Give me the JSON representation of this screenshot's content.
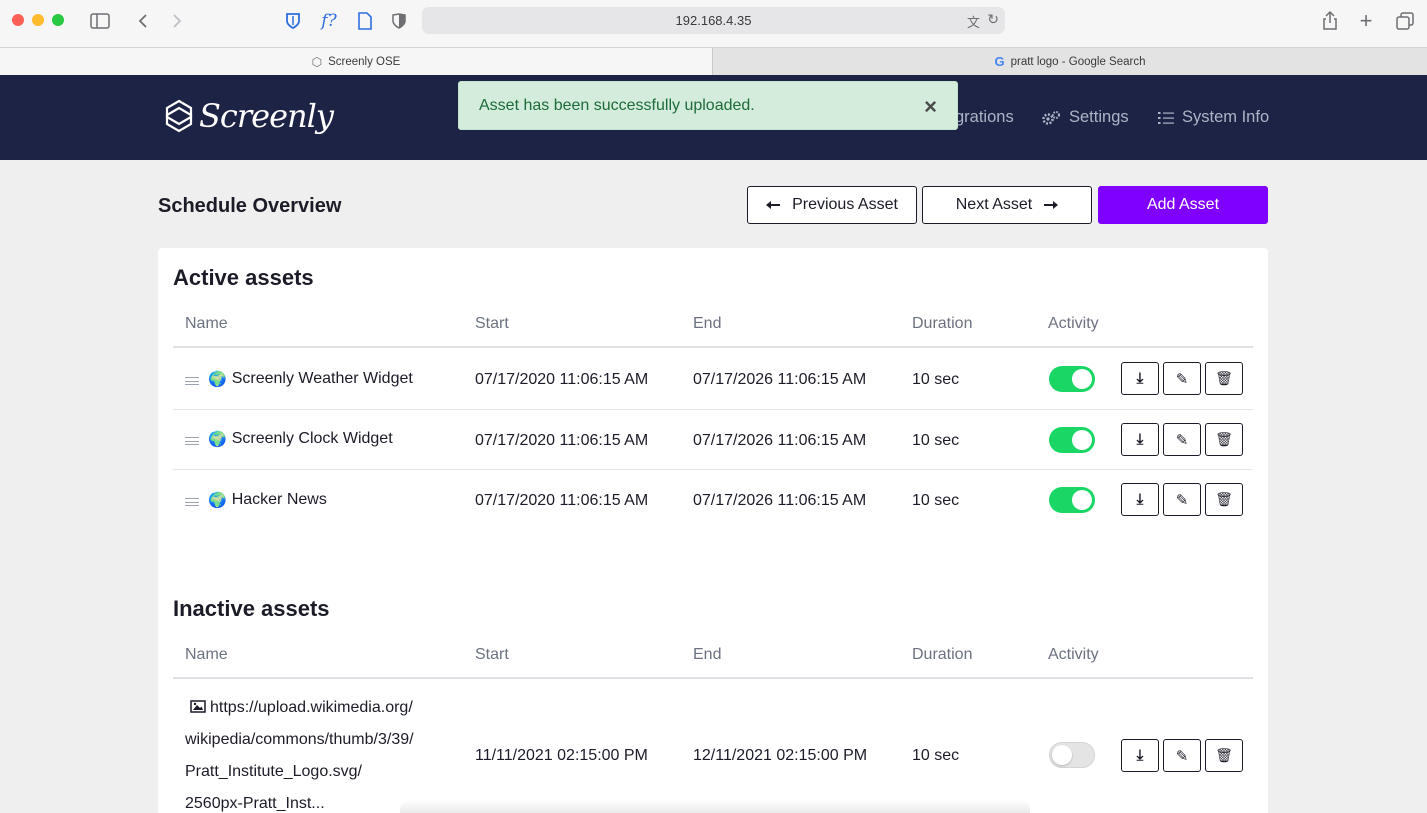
{
  "browser": {
    "address": "192.168.4.35",
    "tabs": [
      {
        "label": "Screenly OSE",
        "active": true
      },
      {
        "label": "pratt logo - Google Search",
        "active": false
      }
    ]
  },
  "navbar": {
    "logo_text": "Screenly",
    "items": [
      {
        "label": "grations",
        "icon": "integrations-icon"
      },
      {
        "label": "Settings",
        "icon": "gears-icon"
      },
      {
        "label": "System Info",
        "icon": "list-icon"
      }
    ]
  },
  "toast": {
    "message": "Asset has been successfully uploaded.",
    "close": "×"
  },
  "header": {
    "title": "Schedule Overview",
    "prev_label": "Previous Asset",
    "next_label": "Next Asset",
    "add_label": "Add Asset"
  },
  "columns": {
    "name": "Name",
    "start": "Start",
    "end": "End",
    "duration": "Duration",
    "activity": "Activity"
  },
  "active": {
    "title": "Active assets",
    "rows": [
      {
        "name": "Screenly Weather Widget",
        "start": "07/17/2020 11:06:15 AM",
        "end": "07/17/2026 11:06:15 AM",
        "duration": "10 sec",
        "enabled": true
      },
      {
        "name": "Screenly Clock Widget",
        "start": "07/17/2020 11:06:15 AM",
        "end": "07/17/2026 11:06:15 AM",
        "duration": "10 sec",
        "enabled": true
      },
      {
        "name": "Hacker News",
        "start": "07/17/2020 11:06:15 AM",
        "end": "07/17/2026 11:06:15 AM",
        "duration": "10 sec",
        "enabled": true
      }
    ]
  },
  "inactive": {
    "title": "Inactive assets",
    "rows": [
      {
        "name_lines": [
          "https://upload.wikimedia.org/",
          "wikipedia/commons/thumb/3/39/",
          "Pratt_Institute_Logo.svg/",
          "2560px-Pratt_Inst..."
        ],
        "start": "11/11/2021 02:15:00 PM",
        "end": "12/11/2021 02:15:00 PM",
        "duration": "10 sec",
        "enabled": false
      }
    ]
  },
  "colors": {
    "navbar": "#1d2345",
    "primary": "#8000ff",
    "toggle_on": "#19d665",
    "toast_bg": "#d3ecdc"
  }
}
